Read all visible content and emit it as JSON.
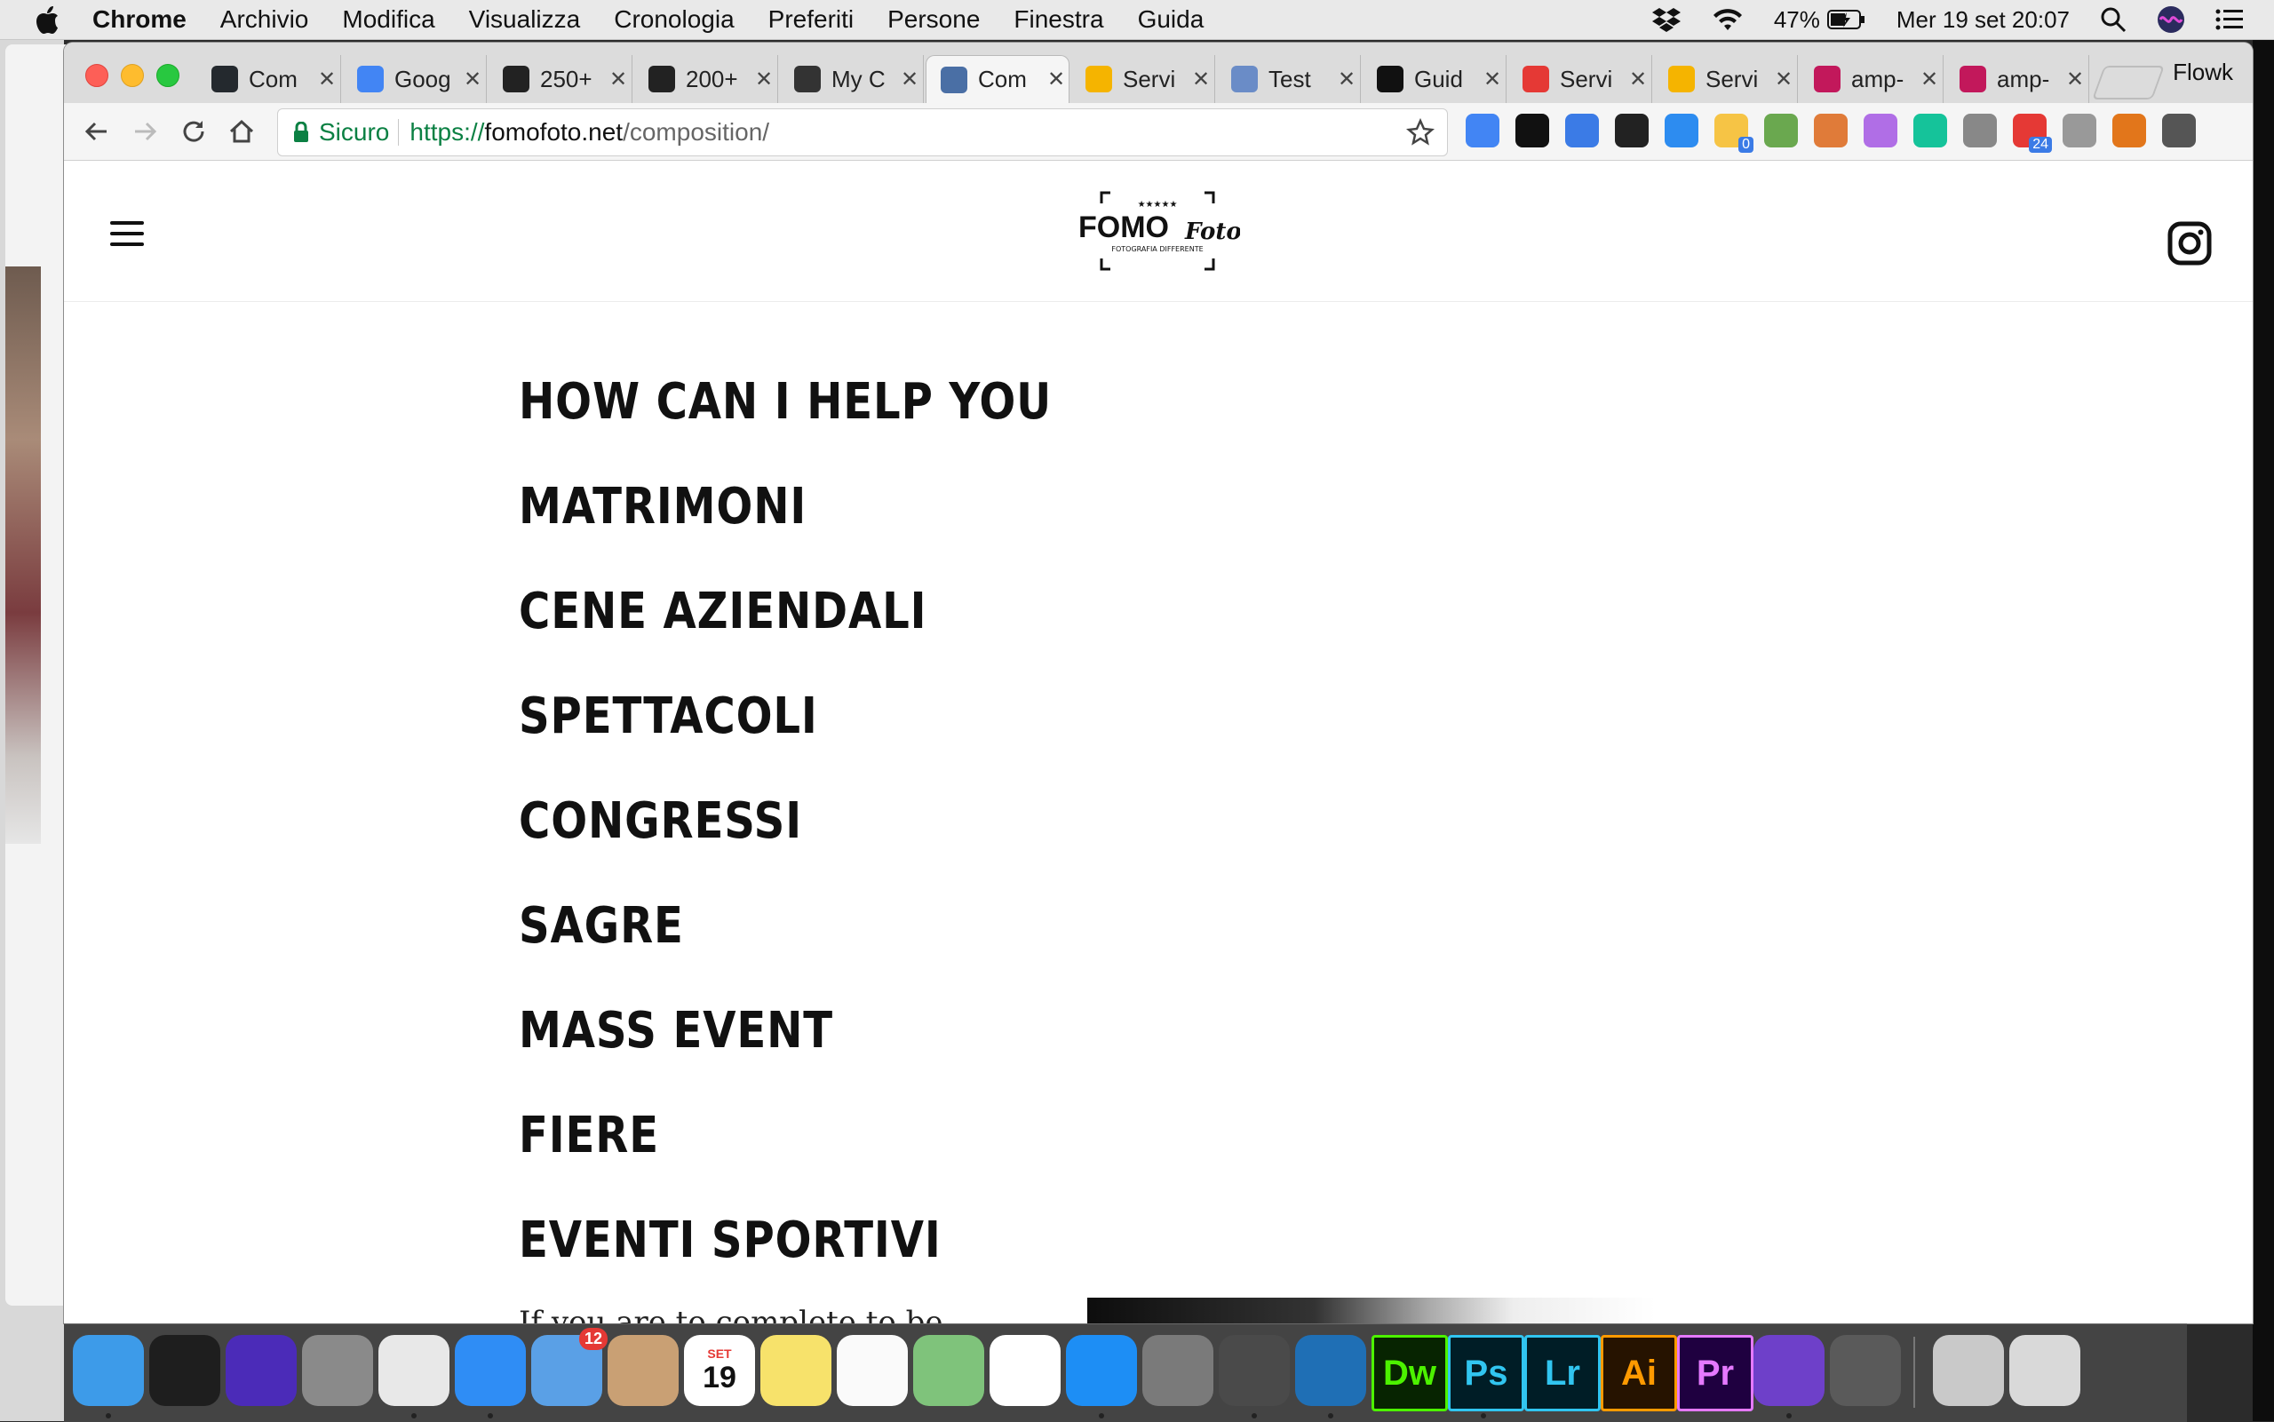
{
  "menubar": {
    "app": "Chrome",
    "items": [
      "Archivio",
      "Modifica",
      "Visualizza",
      "Cronologia",
      "Preferiti",
      "Persone",
      "Finestra",
      "Guida"
    ],
    "battery": "47%",
    "datetime": "Mer 19 set  20:07"
  },
  "tabs": [
    {
      "label": "Com",
      "icon": "github-icon",
      "color": "#24292e"
    },
    {
      "label": "Goog",
      "icon": "google-translate-icon",
      "color": "#4285f4"
    },
    {
      "label": "250+",
      "icon": "instagram-icon",
      "color": "#222222"
    },
    {
      "label": "200+",
      "icon": "instagram-icon",
      "color": "#222222"
    },
    {
      "label": "My C",
      "icon": "aperture-icon",
      "color": "#333333"
    },
    {
      "label": "Com",
      "icon": "camera-site-icon",
      "color": "#4a6fa5"
    },
    {
      "label": "Servi",
      "icon": "seo-icon",
      "color": "#f5b400"
    },
    {
      "label": "Test",
      "icon": "test-icon",
      "color": "#6a8cc7"
    },
    {
      "label": "Guid",
      "icon": "camera-icon",
      "color": "#111111"
    },
    {
      "label": "Servi",
      "icon": "target-icon",
      "color": "#e53935"
    },
    {
      "label": "Servi",
      "icon": "seo-icon",
      "color": "#f5b400"
    },
    {
      "label": "amp-",
      "icon": "amp-icon",
      "color": "#c2185b"
    },
    {
      "label": "amp-",
      "icon": "amp-icon",
      "color": "#c2185b"
    }
  ],
  "active_tab_index": 5,
  "profile": "Flowk",
  "omnibox": {
    "secure_label": "Sicuro",
    "scheme": "https://",
    "host": "fomofoto.net",
    "path": "/composition/"
  },
  "extensions": [
    "google-translate-icon",
    "bulb-icon",
    "chart-icon",
    "stripes-icon",
    "download-icon",
    "folder-icon",
    "puzzle-icon",
    "arc-icon",
    "shape-icon",
    "grammarly-icon",
    "hook-icon",
    "badge24-icon",
    "camera-icon",
    "fox-icon",
    "pen-icon"
  ],
  "extension_badges": {
    "folder-icon": "0",
    "badge24-icon": "24"
  },
  "site": {
    "logo_main": "FOMO",
    "logo_script": "Foto",
    "logo_tagline": "FOTOGRAFIA DIFFERENTE",
    "logo_stars": "★★★★★",
    "services": [
      "HOW CAN I HELP YOU",
      "MATRIMONI",
      "CENE AZIENDALI",
      "SPETTACOLI",
      "CONGRESSI",
      "SAGRE",
      "MASS EVENT",
      "FIERE",
      "EVENTI SPORTIVI"
    ],
    "peek_text": "If you are to complete to be..."
  },
  "dock": {
    "mail_badge": "12",
    "calendar_month": "SET",
    "calendar_day": "19",
    "apps": [
      "finder-icon",
      "terminal-icon",
      "siri-icon",
      "launchpad-icon",
      "chrome-icon",
      "safari-icon",
      "mail-icon",
      "contacts-icon",
      "calendar-icon",
      "notes-icon",
      "reminders-icon",
      "maps-icon",
      "photos-icon",
      "app-store-icon",
      "system-preferences-icon",
      "sublime-text-icon",
      "vscode-icon",
      "dreamweaver-icon",
      "photoshop-icon",
      "lightroom-icon",
      "illustrator-icon",
      "premiere-icon",
      "github-desktop-icon",
      "photo-booth-icon",
      "downloads-stack-icon",
      "trash-icon"
    ],
    "adobe_labels": {
      "dw": "Dw",
      "ps": "Ps",
      "lr": "Lr",
      "ai": "Ai",
      "pr": "Pr"
    }
  }
}
